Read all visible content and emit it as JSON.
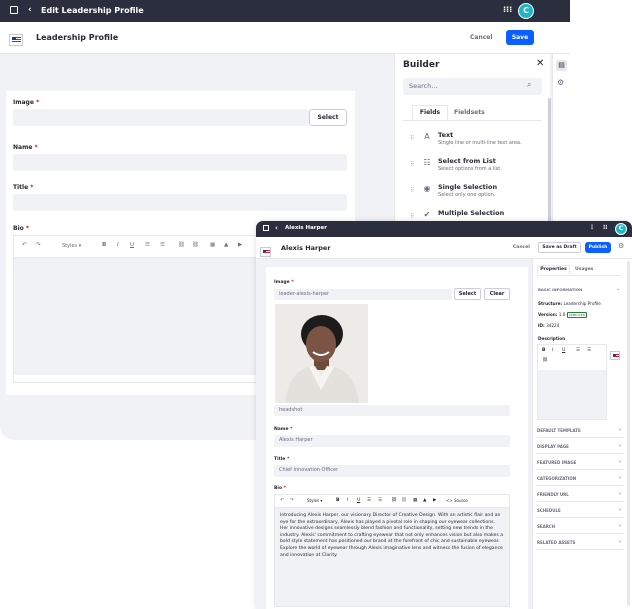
{
  "back": {
    "topbar": {
      "title": "Edit Leadership Profile"
    },
    "header": {
      "title": "Leadership Profile",
      "cancel": "Cancel",
      "save": "Save"
    },
    "form": {
      "image_label": "Image",
      "select_button": "Select",
      "name_label": "Name",
      "title_label": "Title",
      "bio_label": "Bio",
      "styles_label": "Styles"
    },
    "builder": {
      "title": "Builder",
      "search_placeholder": "Search...",
      "tabs": [
        "Fields",
        "Fieldsets"
      ],
      "items": [
        {
          "title": "Text",
          "desc": "Single line or multi-line text area.",
          "icon": "text-icon"
        },
        {
          "title": "Select from List",
          "desc": "Select options from a list.",
          "icon": "list-icon"
        },
        {
          "title": "Single Selection",
          "desc": "Select only one option.",
          "icon": "radio-icon"
        },
        {
          "title": "Multiple Selection",
          "desc": "",
          "icon": "checkbox-icon"
        }
      ]
    }
  },
  "front": {
    "topbar": {
      "title": "Alexis Harper"
    },
    "header": {
      "title": "Alexis Harper",
      "cancel": "Cancel",
      "save_draft": "Save as Draft",
      "publish": "Publish"
    },
    "form": {
      "image_label": "Image",
      "image_value": "leader-alexis-harper",
      "select_button": "Select",
      "clear_button": "Clear",
      "image_caption": "headshot",
      "name_label": "Name",
      "name_value": "Alexis Harper",
      "title_label": "Title",
      "title_value": "Chief Innovation Officer",
      "bio_label": "Bio",
      "styles_label": "Styles",
      "source_label": "Source",
      "bio_text": "Introducing Alexis Harper, our visionary Director of Creative Design. With an artistic flair and an eye for the extraordinary, Alexis has played a pivotal role in shaping our eyewear collections. Her innovative designs seamlessly blend fashion and functionality, setting new trends in the industry. Alexis' commitment to crafting eyewear that not only enhances vision but also makes a bold style statement has positioned our brand at the forefront of chic and sustainable eyewear. Explore the world of eyewear through Alexis imaginative lens and witness the fusion of elegance and innovation at Clarity."
    },
    "panel": {
      "tabs": [
        "Properties",
        "Usages"
      ],
      "basic_info": "BASIC INFORMATION",
      "structure_label": "Structure:",
      "structure_value": "Leadership Profile",
      "version_label": "Version:",
      "version_value": "1.0",
      "version_status": "APPROVED",
      "id_label": "ID:",
      "id_value": "34224",
      "description_label": "Description",
      "sections": [
        "DEFAULT TEMPLATE",
        "DISPLAY PAGE",
        "FEATURED IMAGE",
        "CATEGORIZATION",
        "FRIENDLY URL",
        "SCHEDULE",
        "SEARCH",
        "RELATED ASSETS"
      ]
    }
  },
  "colors": {
    "primary": "#0b5fff",
    "topbar": "#2b2e3e",
    "avatar": "#1fb6c9",
    "approved": "#287d3c"
  }
}
